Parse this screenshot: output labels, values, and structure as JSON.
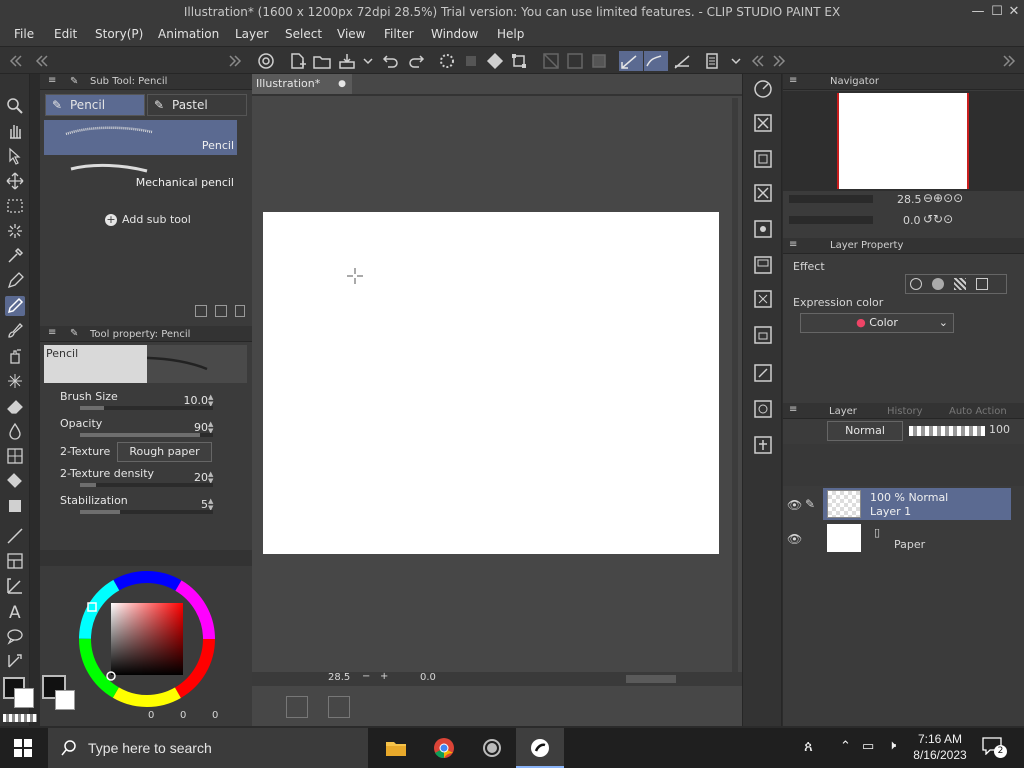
{
  "window": {
    "title": "Illustration* (1600 x 1200px 72dpi 28.5%)  Trial version: You can use limited features. - CLIP STUDIO PAINT EX",
    "minimize": "—",
    "maximize": "☐",
    "close": "✕"
  },
  "menu": [
    "File",
    "Edit",
    "Story(P)",
    "Animation",
    "Layer",
    "Select",
    "View",
    "Filter",
    "Window",
    "Help"
  ],
  "subtool": {
    "panel_title": "Sub Tool: Pencil",
    "tabs": [
      {
        "label": "Pencil"
      },
      {
        "label": "Pastel"
      }
    ],
    "items": [
      {
        "label": "Pencil"
      },
      {
        "label": "Mechanical pencil"
      }
    ],
    "add_label": "Add sub tool"
  },
  "toolprop": {
    "panel_title": "Tool property: Pencil",
    "preview_label": "Pencil",
    "rows": [
      {
        "label": "Brush Size",
        "value": "10.0",
        "level": 0.18
      },
      {
        "label": "Opacity",
        "value": "90",
        "level": 0.9
      },
      {
        "label": "2-Texture",
        "value": "Rough paper"
      },
      {
        "label": "2-Texture density",
        "value": "20",
        "level": 0.12
      },
      {
        "label": "Stabilization",
        "value": "5",
        "level": 0.3
      }
    ]
  },
  "color": {
    "main": "#111111",
    "sub": "#ffffff",
    "values": [
      "0",
      "0",
      "0"
    ]
  },
  "canvas": {
    "tab_label": "Illustration*",
    "zoom": "28.5",
    "rotate": "0.0"
  },
  "navigator": {
    "title": "Navigator",
    "zoom": "28.5",
    "rotate": "0.0"
  },
  "layer_property": {
    "title": "Layer Property",
    "effect_label": "Effect",
    "expression_label": "Expression color",
    "expression_value": "Color"
  },
  "layers_panel": {
    "tabs": [
      "Layer",
      "History",
      "Auto Action"
    ],
    "blend_mode": "Normal",
    "opacity": "100",
    "layers": [
      {
        "line1": "100 % Normal",
        "line2": "Layer 1"
      },
      {
        "line1": "",
        "line2": "Paper"
      }
    ]
  },
  "taskbar": {
    "search_placeholder": "Type here to search",
    "time": "7:16 AM",
    "date": "8/16/2023",
    "notifications": "2"
  }
}
